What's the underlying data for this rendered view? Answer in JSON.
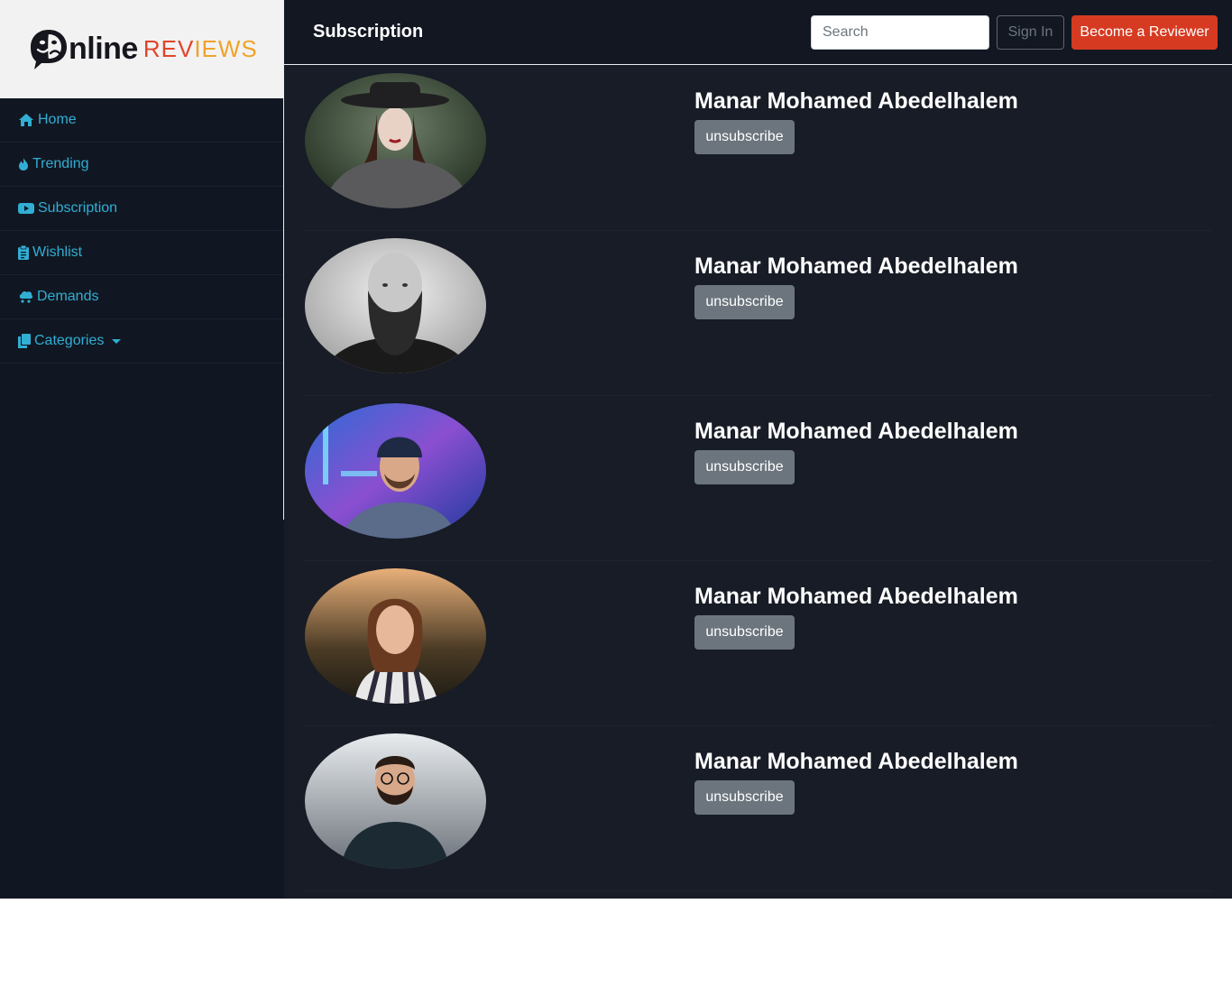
{
  "logo": {
    "text_main": "nline",
    "text_accent_1": "REV",
    "text_accent_2": "IEWS"
  },
  "header": {
    "title": "Subscription",
    "search_placeholder": "Search",
    "signin_label": "Sign In",
    "become_reviewer_label": "Become a Reviewer"
  },
  "sidebar": {
    "items": [
      {
        "label": "Home",
        "icon": "home-icon"
      },
      {
        "label": "Trending",
        "icon": "fire-icon"
      },
      {
        "label": "Subscription",
        "icon": "youtube-icon"
      },
      {
        "label": "Wishlist",
        "icon": "clipboard-icon"
      },
      {
        "label": "Demands",
        "icon": "demands-icon"
      },
      {
        "label": "Categories",
        "icon": "copy-icon",
        "dropdown": true
      }
    ]
  },
  "subscriptions": [
    {
      "name": "Manar Mohamed Abedelhalem",
      "button": "unsubscribe",
      "avatar": "woman-in-hat-avatar"
    },
    {
      "name": "Manar Mohamed Abedelhalem",
      "button": "unsubscribe",
      "avatar": "bearded-man-avatar"
    },
    {
      "name": "Manar Mohamed Abedelhalem",
      "button": "unsubscribe",
      "avatar": "man-in-beanie-neon-avatar"
    },
    {
      "name": "Manar Mohamed Abedelhalem",
      "button": "unsubscribe",
      "avatar": "woman-striped-shirt-avatar"
    },
    {
      "name": "Manar Mohamed Abedelhalem",
      "button": "unsubscribe",
      "avatar": "man-with-glasses-avatar"
    }
  ],
  "colors": {
    "accent": "#31aed4",
    "primary_button": "#d63b22",
    "secondary_button": "#6c757d",
    "background": "#171c26",
    "sidebar": "#111722"
  }
}
